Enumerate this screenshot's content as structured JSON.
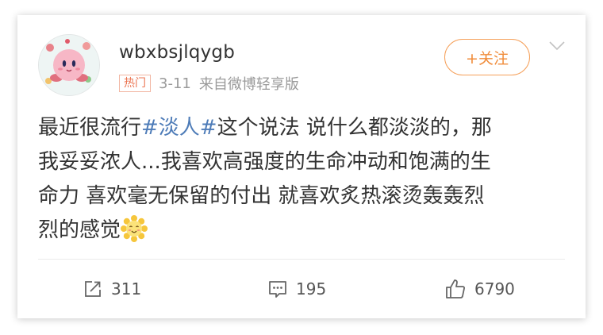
{
  "post": {
    "username": "wbxbsjlqygb",
    "badge": "热门",
    "date": "3-11",
    "source": "来自微博轻享版",
    "follow_label": "+关注",
    "content": {
      "line1_a": "最近很流行",
      "topic": "#淡人#",
      "line1_b": "这个说法 说什么都淡淡的，那",
      "line2": "我妥妥浓人...我喜欢高强度的生命冲动和饱满的生",
      "line3": "命力 喜欢毫无保留的付出 就喜欢炙热滚烫轰轰烈",
      "line4": "烈的感觉"
    }
  },
  "actions": {
    "repost_count": "311",
    "comment_count": "195",
    "like_count": "6790"
  },
  "icons": {
    "avatar": "kirby-avatar",
    "follow": "plus",
    "menu": "chevron-down-icon",
    "emoji": "sun-smile-emoji",
    "repost": "repost-icon",
    "comment": "comment-icon",
    "like": "thumbs-up-icon"
  },
  "colors": {
    "topic": "#4e7cb8",
    "accent": "#f08b39",
    "badge": "#eb7350"
  }
}
